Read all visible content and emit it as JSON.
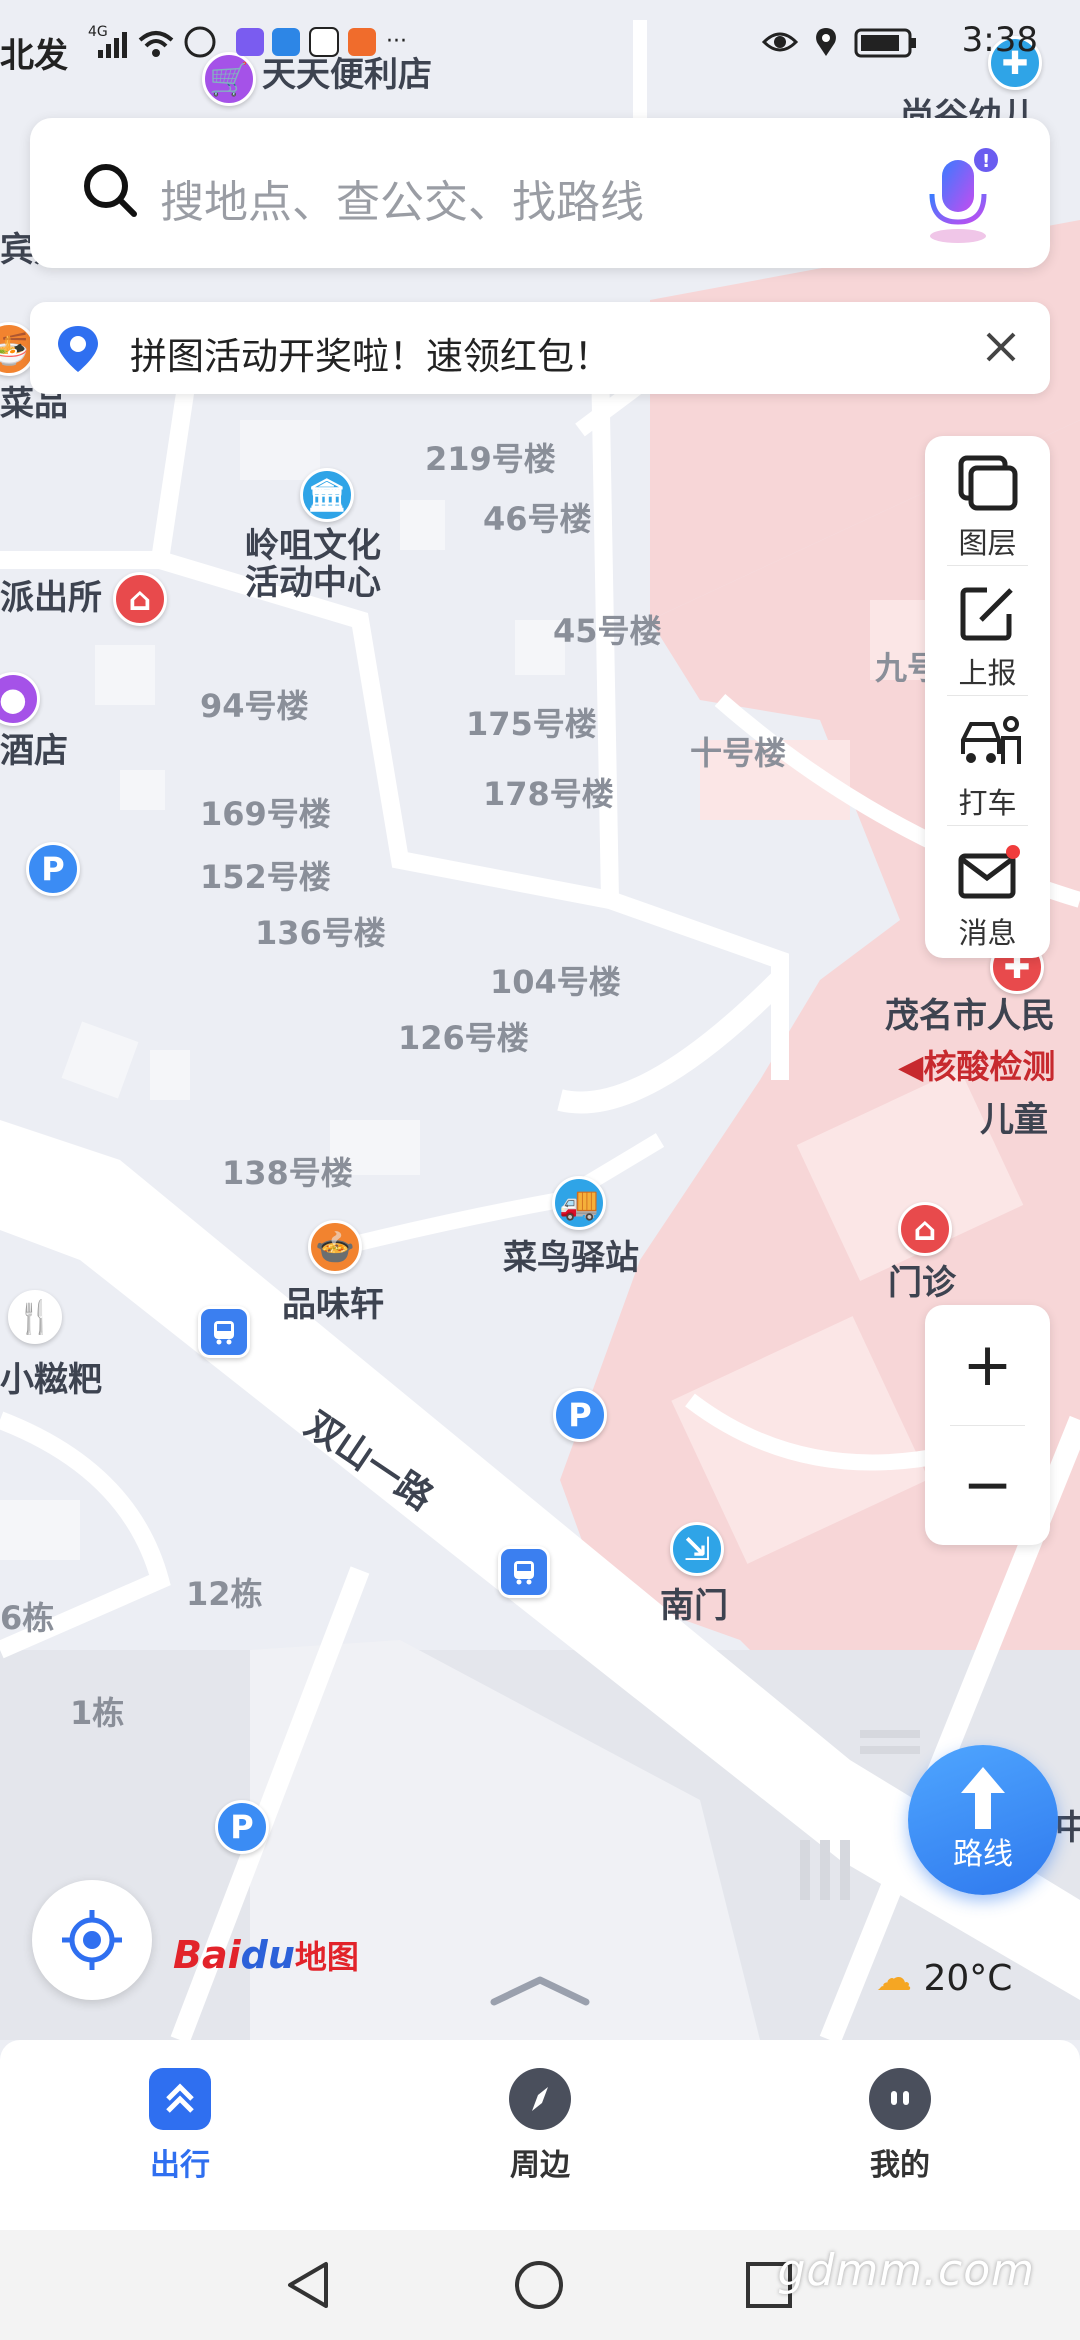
{
  "status_bar": {
    "left_text": "北发",
    "network": "4G",
    "time": "3:38"
  },
  "search": {
    "placeholder": "搜地点、查公交、找路线"
  },
  "banner": {
    "text": "拼图活动开奖啦！速领红包！"
  },
  "map": {
    "poi_labels": {
      "store": "天天便利店",
      "kindergarten": "尚谷幼儿",
      "place_cut": "宾点",
      "restaurant_cut": "菜品",
      "culture_center": "岭咀文化\n活动中心",
      "police": "派出所",
      "hotel": "酒店",
      "station": "菜鸟驿站",
      "pinweixuan": "品味轩",
      "snack": "小糍粑",
      "road": "双山一路",
      "south_gate": "南门",
      "hospital": "茂名市人民",
      "hospital_sub": "核酸检测",
      "child": "儿童",
      "clinic": "门诊",
      "nine": "九号",
      "ten": "十号楼",
      "middle": "中"
    },
    "buildings": [
      "219号楼",
      "46号楼",
      "45号楼",
      "94号楼",
      "175号楼",
      "178号楼",
      "169号楼",
      "152号楼",
      "136号楼",
      "104号楼",
      "126号楼",
      "138号楼",
      "12栋",
      "1栋",
      "6栋"
    ]
  },
  "tools": [
    {
      "label": "图层",
      "icon": "layers-icon"
    },
    {
      "label": "上报",
      "icon": "report-edit-icon"
    },
    {
      "label": "打车",
      "icon": "taxi-icon"
    },
    {
      "label": "消息",
      "icon": "mail-icon"
    }
  ],
  "zoom": {
    "in": "+",
    "out": "−"
  },
  "route_button": {
    "label": "路线"
  },
  "logo": {
    "part1": "Bai",
    "part2": "du",
    "part3": "地图"
  },
  "weather": {
    "temp": "20°C"
  },
  "bottom_nav": [
    {
      "label": "出行",
      "active": true
    },
    {
      "label": "周边",
      "active": false
    },
    {
      "label": "我的",
      "active": false
    }
  ],
  "watermark": "gdmm.com",
  "colors": {
    "accent": "#2f6ff0",
    "hospital_zone": "#f8d8d8",
    "map_bg": "#eceef4"
  }
}
